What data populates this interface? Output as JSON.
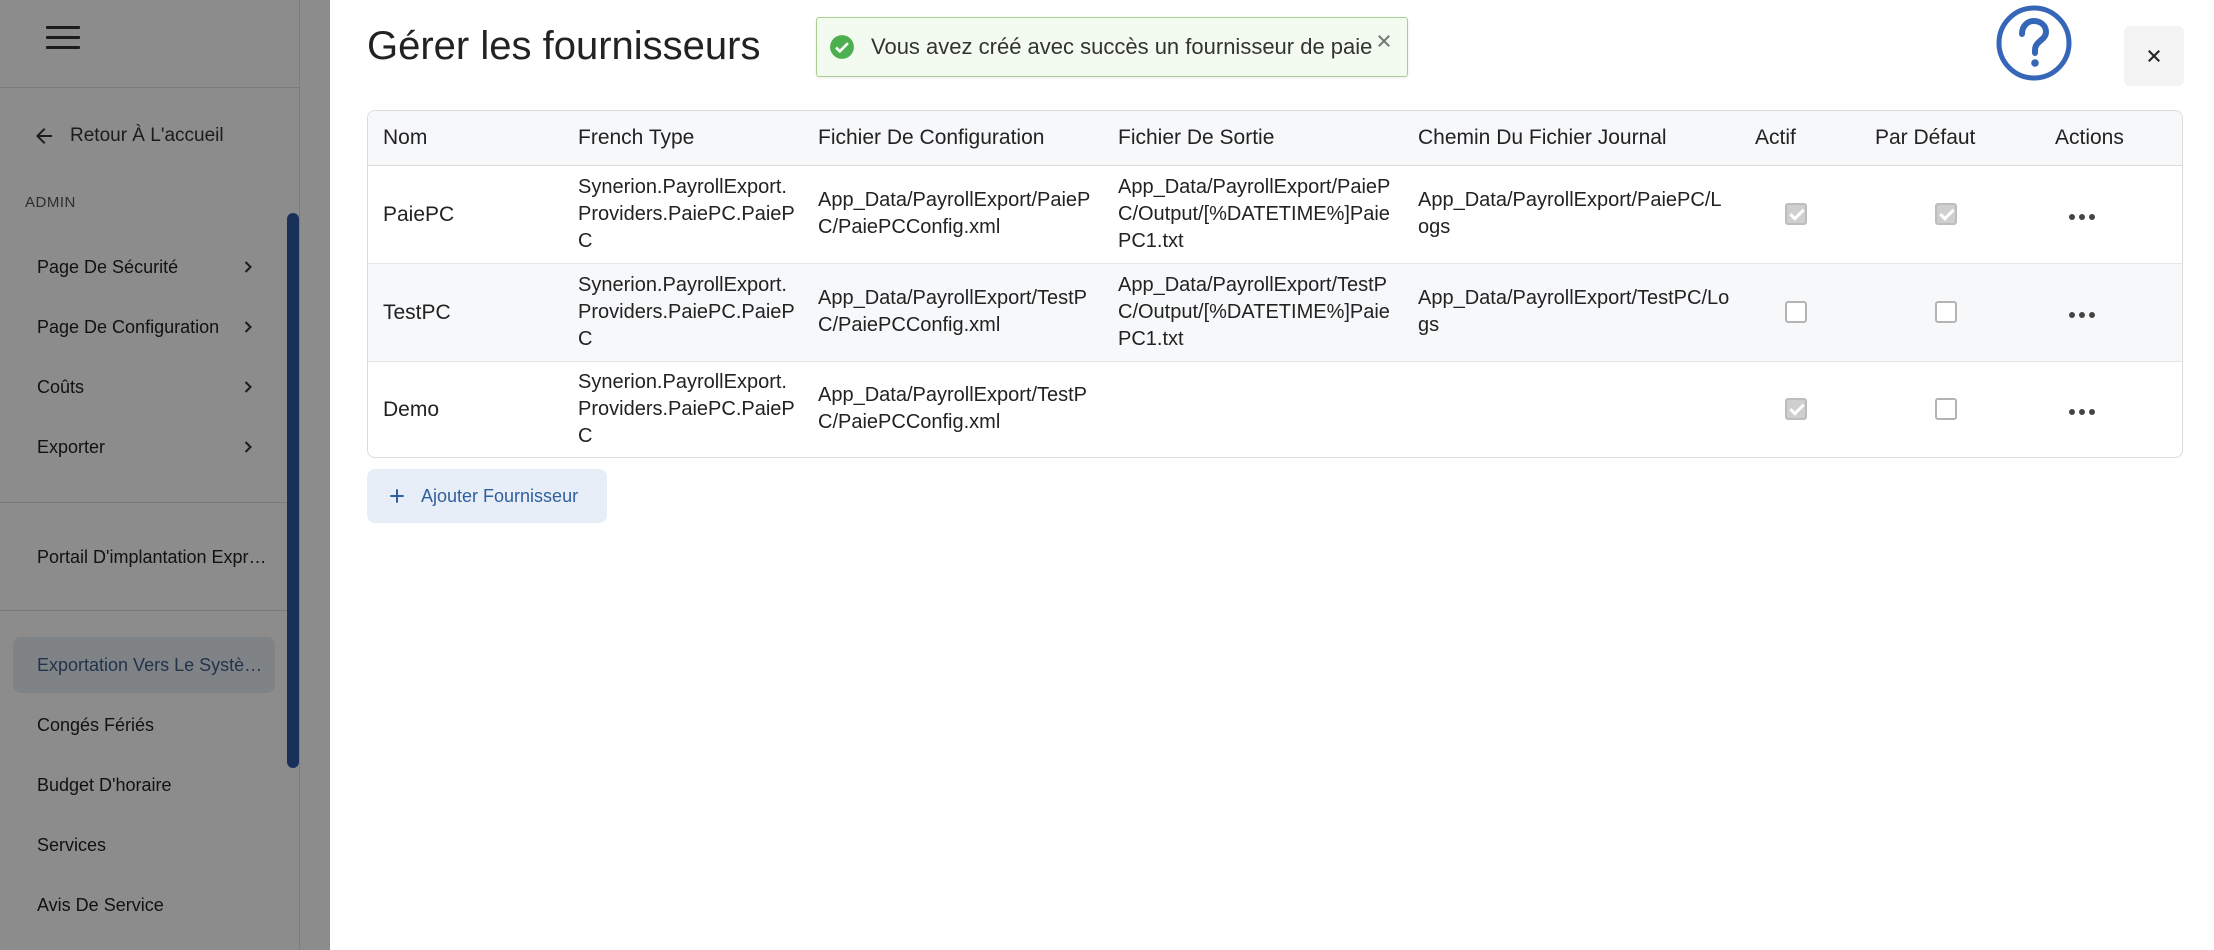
{
  "sidebar": {
    "back_label": "Retour À L'accueil",
    "section_label": "ADMIN",
    "group1": [
      {
        "label": "Page De Sécurité"
      },
      {
        "label": "Page De Configuration"
      },
      {
        "label": "Coûts"
      },
      {
        "label": "Exporter"
      }
    ],
    "portal_label": "Portail D'implantation Expr…",
    "group2": [
      {
        "label": "Exportation Vers Le Systè…"
      },
      {
        "label": "Congés Fériés"
      },
      {
        "label": "Budget D'horaire"
      },
      {
        "label": "Services"
      },
      {
        "label": "Avis De Service"
      }
    ]
  },
  "modal": {
    "title": "Gérer les fournisseurs",
    "toast": "Vous avez créé avec succès un fournisseur de paie",
    "add_button": "Ajouter Fournisseur"
  },
  "table": {
    "headers": {
      "name": "Nom",
      "type": "French Type",
      "config": "Fichier De Configuration",
      "output": "Fichier De Sortie",
      "log": "Chemin Du Fichier Journal",
      "active": "Actif",
      "default": "Par Défaut",
      "actions": "Actions"
    },
    "rows": [
      {
        "name": "PaiePC",
        "type": "Synerion.PayrollExport.Providers.PaiePC.PaiePC",
        "config": "App_Data/PayrollExport/PaiePC/PaiePCConfig.xml",
        "output": "App_Data/PayrollExport/PaiePC/Output/[%DATETIME%]PaiePC1.txt",
        "log": "App_Data/PayrollExport/PaiePC/Logs",
        "active": true,
        "default": true
      },
      {
        "name": "TestPC",
        "type": "Synerion.PayrollExport.Providers.PaiePC.PaiePC",
        "config": "App_Data/PayrollExport/TestPC/PaiePCConfig.xml",
        "output": "App_Data/PayrollExport/TestPC/Output/[%DATETIME%]PaiePC1.txt",
        "log": "App_Data/PayrollExport/TestPC/Logs",
        "active": false,
        "default": false
      },
      {
        "name": "Demo",
        "type": "Synerion.PayrollExport.Providers.PaiePC.PaiePC",
        "config": "App_Data/PayrollExport/TestPC/PaiePCConfig.xml",
        "output": "",
        "log": "",
        "active": true,
        "default": false
      }
    ]
  },
  "colors": {
    "accent": "#2f58a7",
    "success_bg": "#f3fbf0",
    "success_border": "#a9cf93",
    "success_icon": "#4caf50",
    "overlay": "#737373"
  },
  "icons": {
    "menu": "hamburger-icon",
    "back": "arrow-left-icon",
    "chevron": "chevron-right-icon",
    "success": "check-circle-icon",
    "toast_close": "close-icon",
    "help": "help-circle-icon",
    "modal_close": "close-icon",
    "row_actions": "more-horizontal-icon",
    "add": "plus-icon"
  }
}
